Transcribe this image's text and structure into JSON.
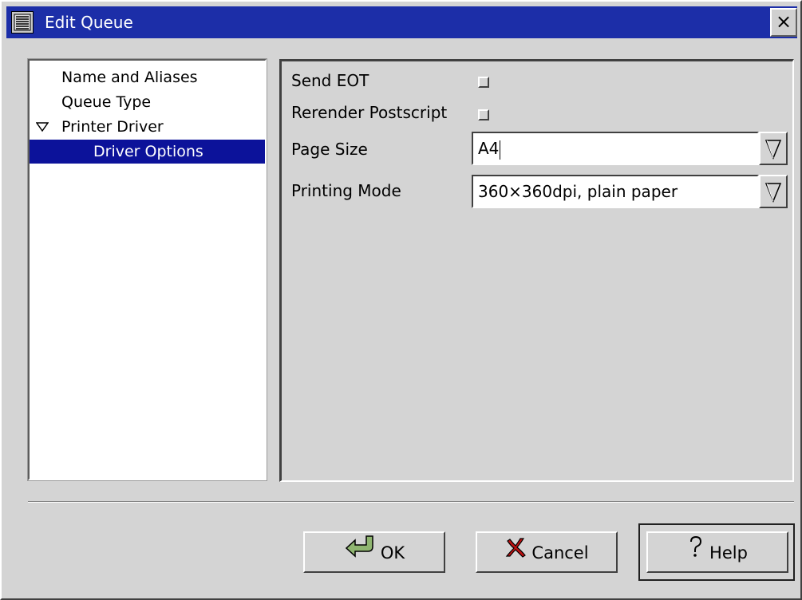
{
  "window": {
    "title": "Edit Queue",
    "close_label": "×"
  },
  "tree": {
    "items": [
      {
        "label": "Name and Aliases"
      },
      {
        "label": "Queue Type"
      },
      {
        "label": "Printer Driver"
      },
      {
        "label": "Driver Options"
      }
    ]
  },
  "options": {
    "send_eot_label": "Send EOT",
    "rerender_label": "Rerender Postscript",
    "page_size_label": "Page Size",
    "page_size_value": "A4",
    "printing_mode_label": "Printing Mode",
    "printing_mode_value": "360×360dpi, plain paper"
  },
  "buttons": {
    "ok_label": "OK",
    "cancel_label": "Cancel",
    "help_label": "Help"
  },
  "colors": {
    "titlebar": "#1c2ea8",
    "selection": "#0c129a",
    "background": "#d4d4d4"
  },
  "icons": {
    "window_menu": "window-menu-icon",
    "close": "close-icon",
    "expander": "triangle-down-icon",
    "combo_arrow": "combo-arrow-icon",
    "ok": "ok-arrow-icon",
    "cancel": "cancel-x-icon",
    "help": "help-question-icon"
  }
}
